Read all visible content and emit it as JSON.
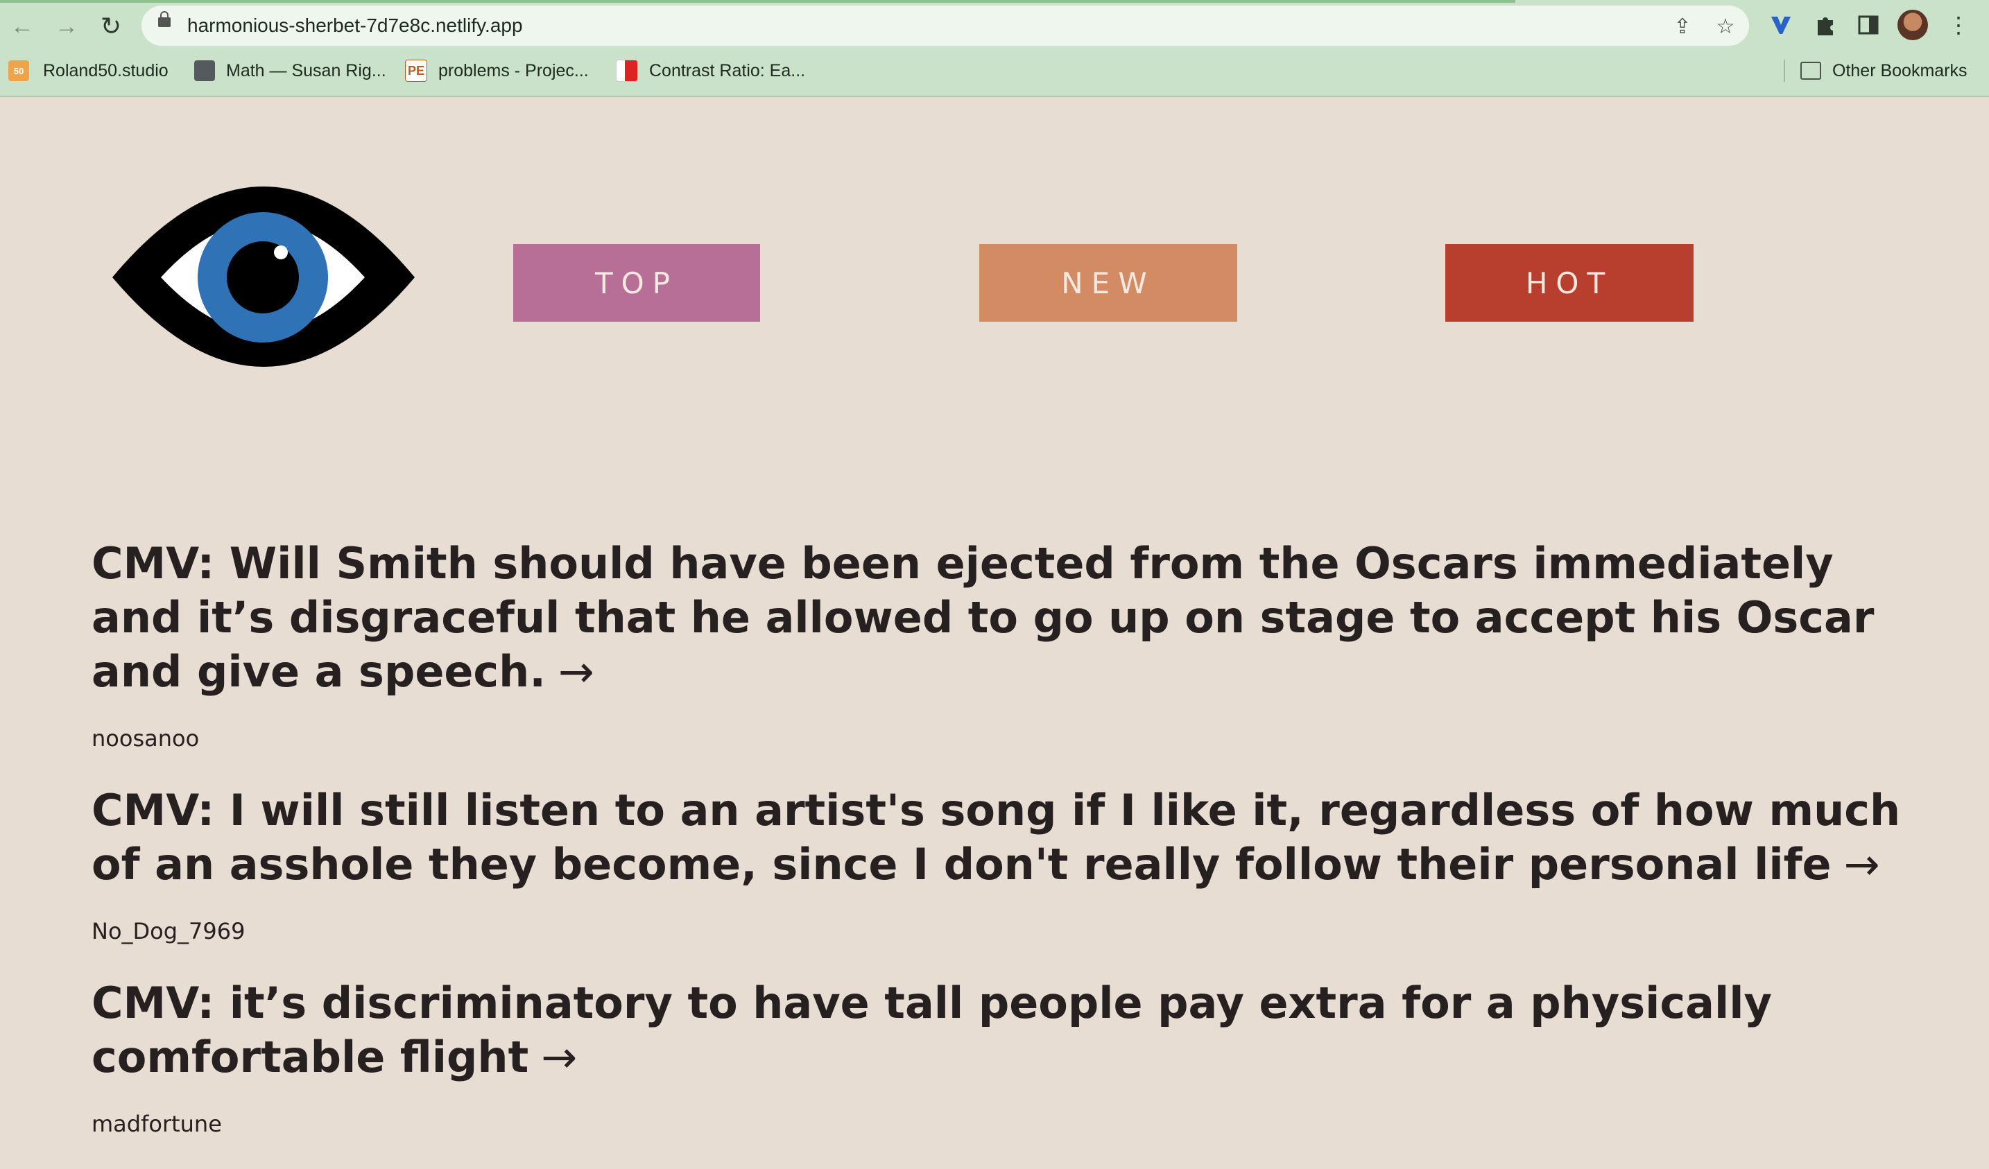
{
  "browser": {
    "url": "harmonious-sherbet-7d7e8c.netlify.app",
    "bookmarks": [
      {
        "label": "Roland50.studio",
        "icon": "roland50-favicon"
      },
      {
        "label": "Math — Susan Rig...",
        "icon": "cube-favicon"
      },
      {
        "label": "problems - Projec...",
        "icon": "pe-favicon",
        "icon_text": "PE"
      },
      {
        "label": "Contrast Ratio: Ea...",
        "icon": "contrast-ratio-favicon"
      }
    ],
    "other_bookmarks": "Other Bookmarks"
  },
  "nav": {
    "buttons": [
      {
        "label": "TOP",
        "color": "#b86f97"
      },
      {
        "label": "NEW",
        "color": "#d38b63"
      },
      {
        "label": "HOT",
        "color": "#b83e2e"
      }
    ]
  },
  "posts": [
    {
      "title": "CMV: Will Smith should have been ejected from the Oscars immediately and it’s disgraceful that he allowed to go up on stage to accept his Oscar and give a speech.",
      "author": "noosanoo"
    },
    {
      "title": "CMV: I will still listen to an artist's song if I like it, regardless of how much of an asshole they become, since I don't really follow their personal life",
      "author": "No_Dog_7969"
    },
    {
      "title": "CMV: it’s discriminatory to have tall people pay extra for a physically comfortable flight",
      "author": "madfortune"
    }
  ],
  "arrow": "→",
  "colors": {
    "page_bg": "#e8ddd2",
    "chrome_bg": "#c9e2c9",
    "iris": "#2f72b6",
    "text": "#262020"
  }
}
